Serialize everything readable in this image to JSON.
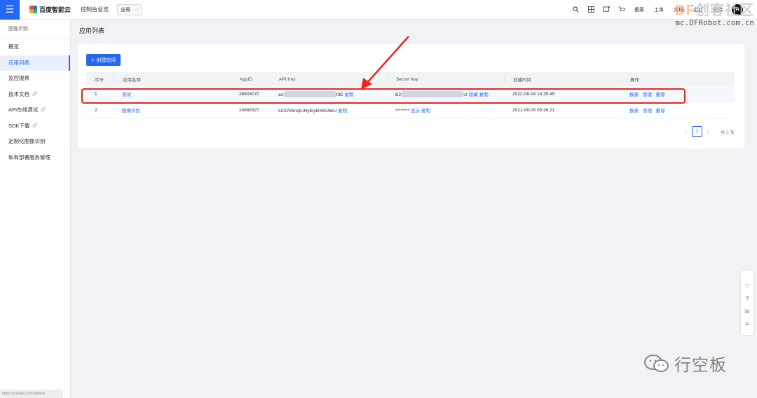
{
  "topbar": {
    "menu_icon": "☰",
    "logo_text": "百度智能云",
    "console_link": "控制台总览",
    "region": "全局",
    "right_icons": [
      "search-icon",
      "grid-icon",
      "message-icon",
      "cart-icon"
    ],
    "links": [
      "备案",
      "工单",
      "文档",
      "企业",
      "支持"
    ],
    "avatar_letter": "H"
  },
  "sidebar": {
    "heading": "图像识别",
    "items": [
      {
        "label": "概览",
        "active": false,
        "external": false
      },
      {
        "label": "应用列表",
        "active": true,
        "external": false
      },
      {
        "label": "监控报表",
        "active": false,
        "external": false
      },
      {
        "label": "技术文档",
        "active": false,
        "external": true
      },
      {
        "label": "API在线调试",
        "active": false,
        "external": true
      },
      {
        "label": "SDK下载",
        "active": false,
        "external": true
      },
      {
        "label": "定制化图像识别",
        "active": false,
        "external": false
      },
      {
        "label": "私有部署服务管理",
        "active": false,
        "external": false
      }
    ],
    "status_url": "https://ai.baidu.com/sdk#vis"
  },
  "main": {
    "title": "应用列表",
    "create_button": "创建应用",
    "table": {
      "headers": [
        "序号",
        "应用名称",
        "AppID",
        "API Key",
        "Secret Key",
        "创建时间",
        "操作"
      ],
      "rows": [
        {
          "no": "1",
          "name": "测试",
          "appid": "26903070",
          "api_key_prefix": "ac",
          "api_key_suffix": "0tE",
          "api_key_copy": "复制",
          "secret_prefix": "B2",
          "secret_suffix": "/z",
          "secret_hide": "隐藏",
          "secret_copy": "复制",
          "created": "2022-08-04 14:39:45",
          "ops": [
            "报表",
            "管理",
            "删除"
          ]
        },
        {
          "no": "2",
          "name": "图像识别",
          "appid": "24668327",
          "api_key": "5C9789nqtUHylEjdtlXBUbkU",
          "api_key_copy": "复制",
          "secret_masked": "********",
          "secret_show": "显示",
          "secret_copy": "复制",
          "created": "2021-08-09 00:36:21",
          "ops": [
            "报表",
            "管理",
            "删除"
          ]
        }
      ]
    },
    "pagination": {
      "current": "1",
      "total_text": "共 2 条"
    }
  },
  "watermarks": {
    "dfrobot_df": "DF",
    "dfrobot_text": "创客社区",
    "dfrobot_url": "mc.DFRobot.com.cn",
    "wechat_text": "行空板"
  },
  "colors": {
    "accent": "#2468f2",
    "annotation": "#e8271f"
  }
}
